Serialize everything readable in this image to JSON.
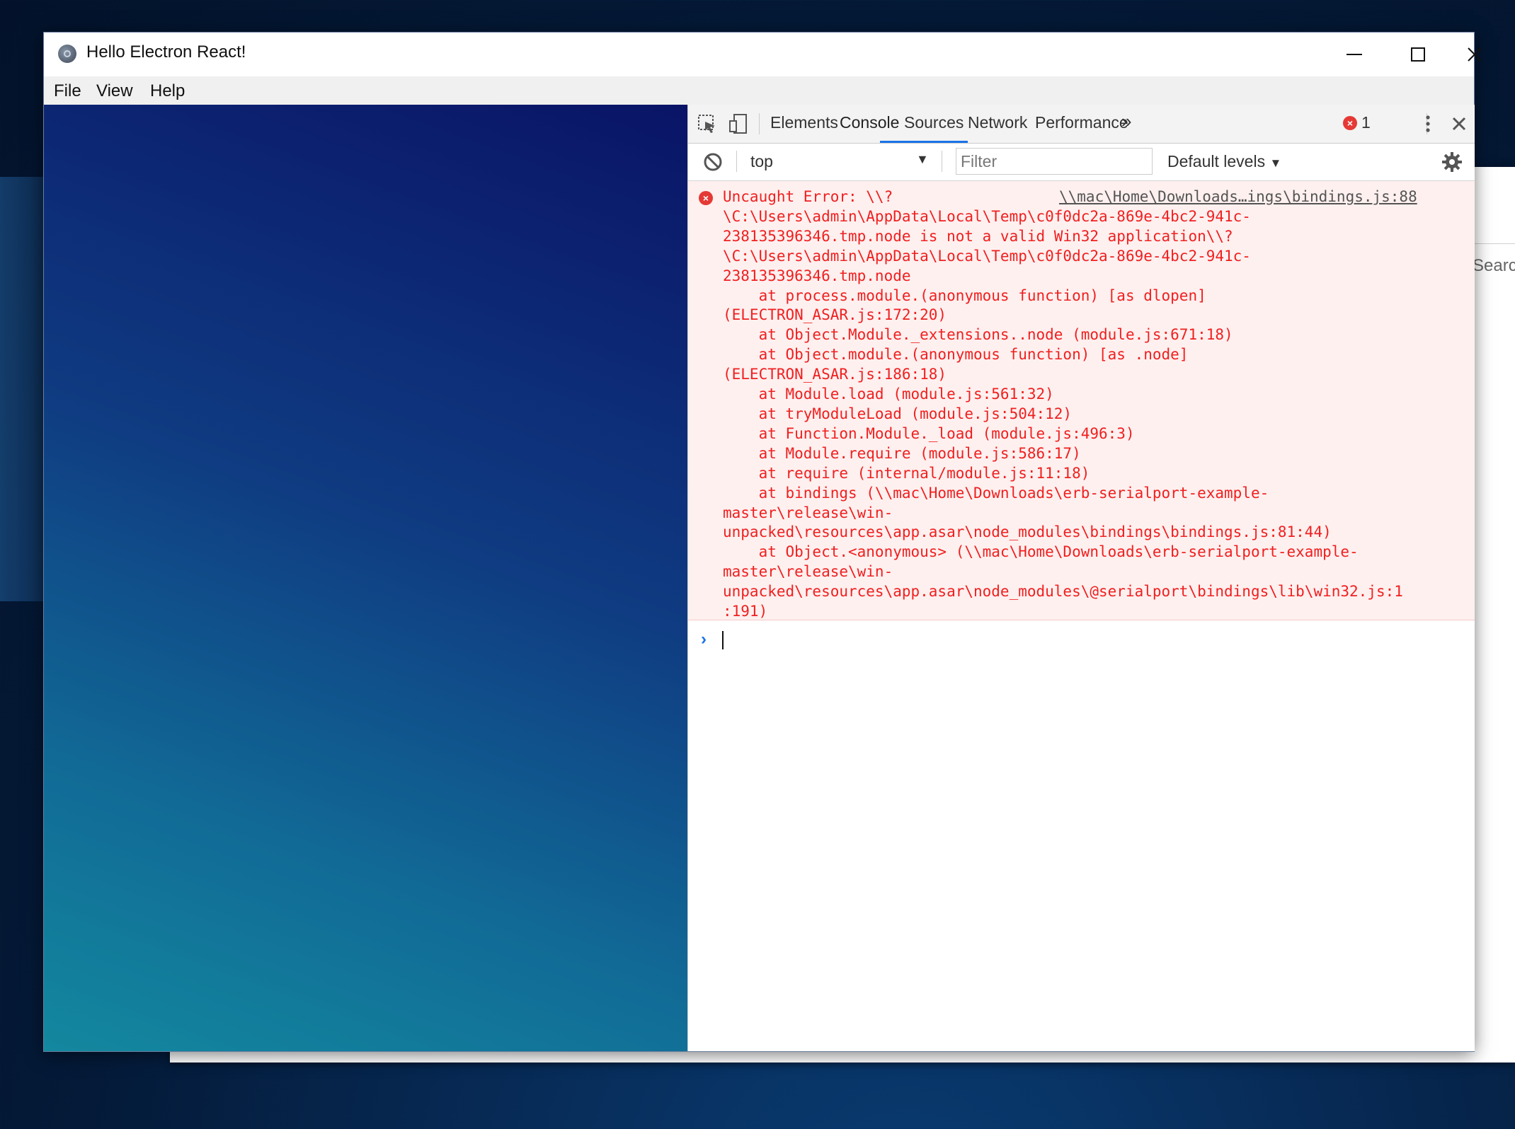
{
  "background_window": {
    "search_text": "Search"
  },
  "window": {
    "title": "Hello Electron React!"
  },
  "menu": {
    "items": [
      "File",
      "View",
      "Help"
    ]
  },
  "devtools": {
    "tabs": [
      "Elements",
      "Console",
      "Sources",
      "Network",
      "Performance"
    ],
    "active_tab": "Console",
    "more_tabs": "»",
    "error_count": "1",
    "context": "top",
    "filter_placeholder": "Filter",
    "levels": "Default levels",
    "colors": {
      "accent": "#1a73e8",
      "error": "#f01f1f",
      "error_bg": "#fef0ef"
    }
  },
  "console": {
    "source_link": "\\\\mac\\Home\\Downloads…ings\\bindings.js:88",
    "error_lines": [
      "Uncaught Error: \\\\?",
      "\\C:\\Users\\admin\\AppData\\Local\\Temp\\c0f0dc2a-869e-4bc2-941c-",
      "238135396346.tmp.node is not a valid Win32 application\\\\?",
      "\\C:\\Users\\admin\\AppData\\Local\\Temp\\c0f0dc2a-869e-4bc2-941c-",
      "238135396346.tmp.node",
      "    at process.module.(anonymous function) [as dlopen]",
      "(ELECTRON_ASAR.js:172:20)",
      "    at Object.Module._extensions..node (module.js:671:18)",
      "    at Object.module.(anonymous function) [as .node]",
      "(ELECTRON_ASAR.js:186:18)",
      "    at Module.load (module.js:561:32)",
      "    at tryModuleLoad (module.js:504:12)",
      "    at Function.Module._load (module.js:496:3)",
      "    at Module.require (module.js:586:17)",
      "    at require (internal/module.js:11:18)",
      "    at bindings (\\\\mac\\Home\\Downloads\\erb-serialport-example-",
      "master\\release\\win-",
      "unpacked\\resources\\app.asar\\node_modules\\bindings\\bindings.js:81:44)",
      "    at Object.<anonymous> (\\\\mac\\Home\\Downloads\\erb-serialport-example-",
      "master\\release\\win-",
      "unpacked\\resources\\app.asar\\node_modules\\@serialport\\bindings\\lib\\win32.js:1",
      ":191)"
    ],
    "prompt_symbol": "›"
  }
}
